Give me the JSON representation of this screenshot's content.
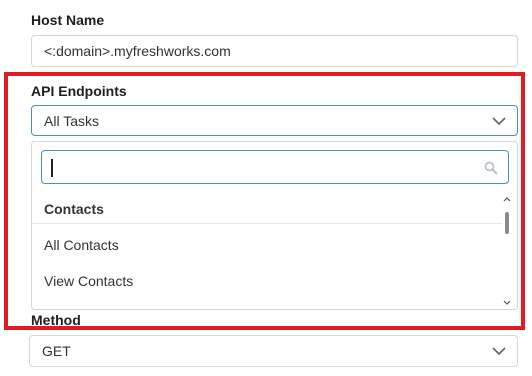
{
  "host": {
    "label": "Host Name",
    "value": "<:domain>.myfreshworks.com"
  },
  "api": {
    "label": "API Endpoints",
    "selected": "All Tasks",
    "search_value": "",
    "groups": [
      {
        "header": "Contacts",
        "options": [
          "All Contacts",
          "View Contacts"
        ]
      }
    ]
  },
  "method": {
    "label": "Method",
    "selected": "GET"
  },
  "colors": {
    "highlight": "#e01b24",
    "focus_border": "#4a8fc9",
    "border": "#cfd7df"
  }
}
